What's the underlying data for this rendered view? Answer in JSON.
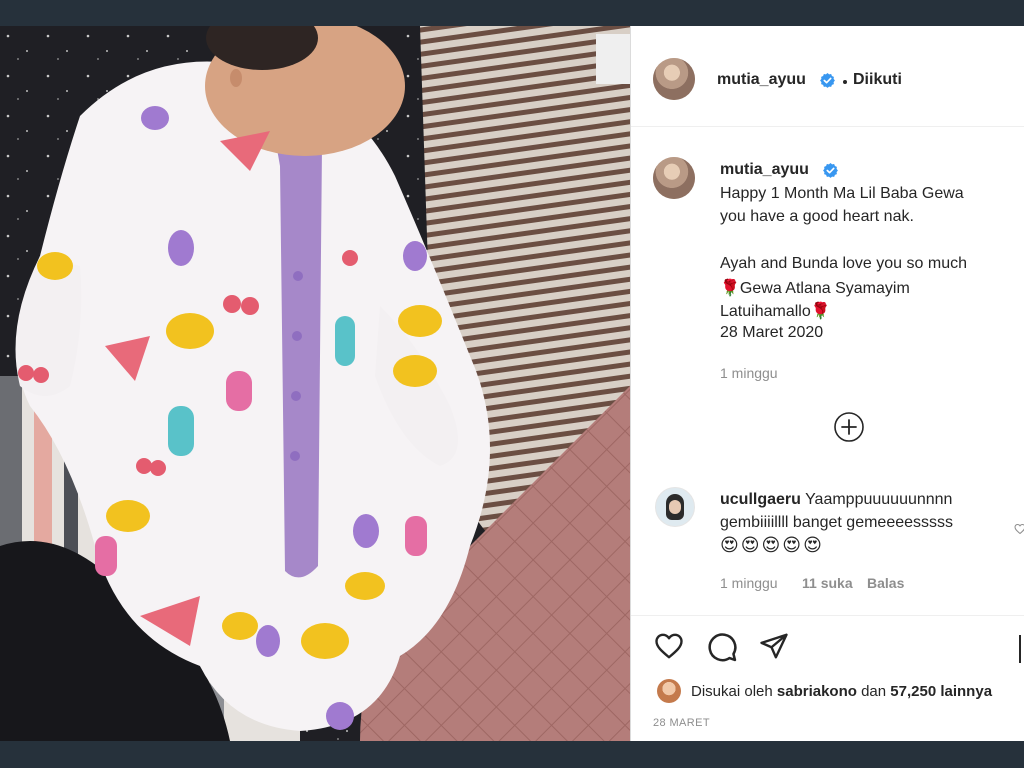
{
  "post": {
    "author": "mutia_ayuu",
    "follow_separator": "•",
    "follow_state": "Diikuti",
    "caption": {
      "line1": "Happy 1 Month Ma Lil Baba Gewa",
      "line2": "you have a good heart nak.",
      "line3": "Ayah and Bunda love you so much",
      "line4": "🌹Gewa Atlana Syamayim",
      "line5": "Latuihamallo🌹",
      "line6": "28 Maret 2020"
    },
    "caption_time": "1 minggu",
    "comment": {
      "author": "ucullgaeru",
      "text1": "Yaamppuuuuuunnnn",
      "text2": "gembiiiillll banget gemeeeesssss",
      "emojis": [
        "😍",
        "😍",
        "😍",
        "😍",
        "😍"
      ],
      "time": "1 minggu",
      "likes": "11 suka",
      "reply": "Balas"
    },
    "likes": {
      "prefix": "Disukai oleh",
      "user": "sabriakono",
      "connector": "dan",
      "count": "57,250 lainnya"
    },
    "date": "28 MARET"
  },
  "icons": {
    "add_comments": "plus-circle-icon",
    "like": "heart-icon",
    "comment": "comment-icon",
    "share": "paper-plane-icon",
    "verified": "verified-badge-icon"
  },
  "colors": {
    "verified": "#3897f0",
    "text": "#262626",
    "muted": "#8e8e8e"
  }
}
